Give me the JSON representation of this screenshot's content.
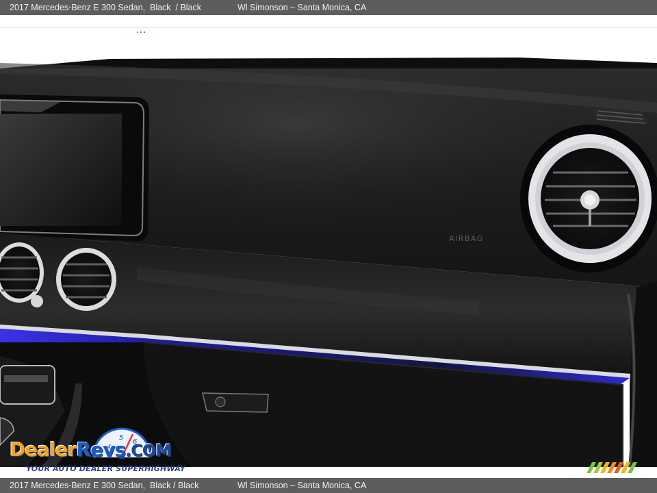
{
  "header": {
    "vehicle": "2017 Mercedes-Benz E 300 Sedan,  Black  / Black",
    "dealer": "Wl Simonson – Santa Monica, CA"
  },
  "footer": {
    "vehicle": "2017 Mercedes-Benz E 300 Sedan,  Black / Black",
    "dealer": "Wl Simonson – Santa Monica, CA"
  },
  "photo": {
    "airbag_label": "AIRBAG"
  },
  "watermark": {
    "brand_a": "Dealer",
    "brand_b": "Revs",
    "brand_c": ".COM",
    "tagline": "YOUR AUTO DEALER SUPERHIGHWAY"
  },
  "colors": {
    "bar": "#5d5d5d",
    "dash": "#151515",
    "ambient": "#2f2fd6",
    "chrome": "#d9dbe0",
    "logo_orange": "#f4a21c",
    "logo_blue": "#1c5cc8"
  }
}
